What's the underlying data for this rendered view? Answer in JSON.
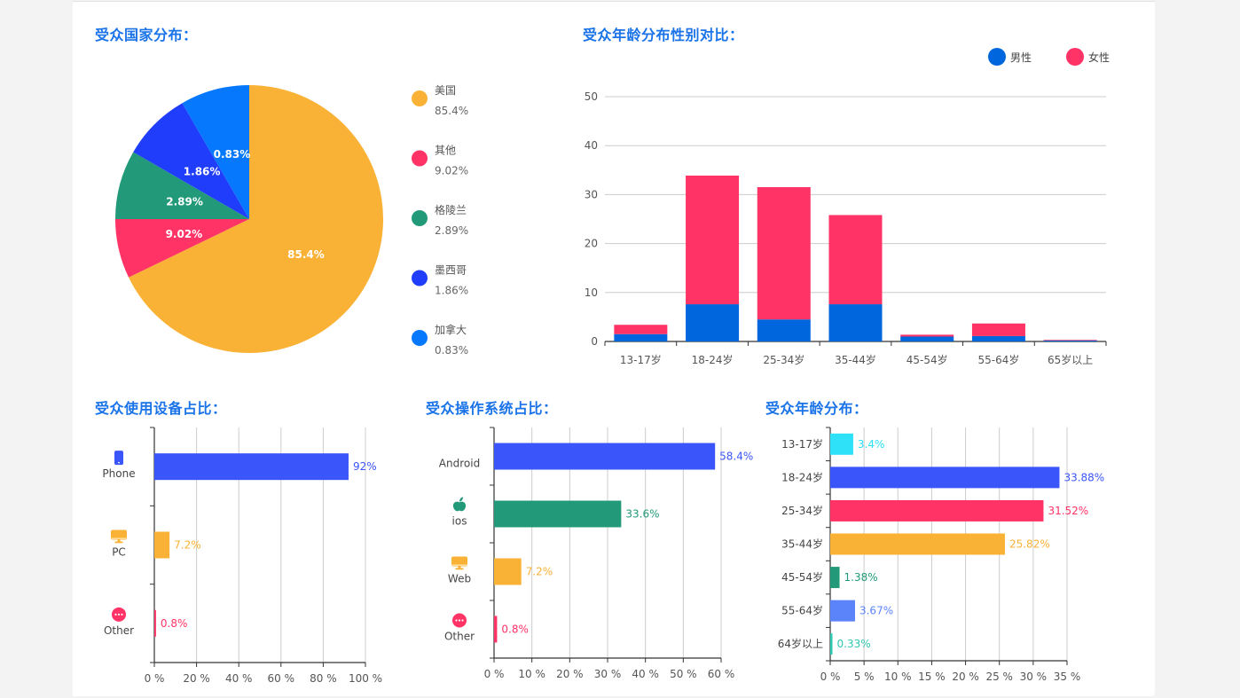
{
  "page": {
    "background": "#f3f3f3",
    "title_color": "#1a73e8"
  },
  "chart_data": [
    {
      "id": "country",
      "type": "pie",
      "title": "受众国家分布：",
      "legend_position": "right",
      "labels_inside": true,
      "slices": [
        {
          "name": "美国",
          "value": 85.4,
          "label": "85.4%",
          "color": "#f9b236"
        },
        {
          "name": "其他",
          "value": 9.02,
          "label": "9.02%",
          "color": "#ff3366"
        },
        {
          "name": "格陵兰",
          "value": 2.89,
          "label": "2.89%",
          "color": "#229a79"
        },
        {
          "name": "墨西哥",
          "value": 1.86,
          "label": "1.86%",
          "color": "#1f3dfb"
        },
        {
          "name": "加拿大",
          "value": 0.83,
          "label": "0.83%",
          "color": "#0678fd"
        }
      ]
    },
    {
      "id": "age_gender",
      "type": "bar",
      "stacked": true,
      "title": "受众年龄分布性别对比：",
      "legend_position": "top-right",
      "categories": [
        "13-17岁",
        "18-24岁",
        "25-34岁",
        "35-44岁",
        "45-54岁",
        "55-64岁",
        "65岁以上"
      ],
      "series": [
        {
          "name": "男性",
          "color": "#0066dd",
          "values": [
            1.5,
            7.6,
            4.5,
            7.6,
            1.0,
            1.1,
            0.2
          ]
        },
        {
          "name": "女性",
          "color": "#ff3366",
          "values": [
            1.9,
            26.28,
            27.02,
            18.22,
            0.38,
            2.57,
            0.13
          ]
        }
      ],
      "ylim": [
        0,
        50
      ],
      "yticks": [
        0,
        10,
        20,
        30,
        40,
        50
      ],
      "grid": true,
      "xlabel": "",
      "ylabel": ""
    },
    {
      "id": "device",
      "type": "bar",
      "orientation": "horizontal",
      "title": "受众使用设备占比：",
      "categories": [
        {
          "name": "Phone",
          "icon": "phone-icon",
          "value": 92,
          "label": "92%",
          "color": "#3a55fa"
        },
        {
          "name": "PC",
          "icon": "monitor-icon",
          "value": 7.2,
          "label": "7.2%",
          "color": "#f9b236"
        },
        {
          "name": "Other",
          "icon": "more-icon",
          "value": 0.8,
          "label": "0.8%",
          "color": "#ff3366"
        }
      ],
      "xlim": [
        0,
        100
      ],
      "xticks": [
        "0 %",
        "20 %",
        "40 %",
        "60 %",
        "80 %",
        "100 %"
      ],
      "grid": true
    },
    {
      "id": "os",
      "type": "bar",
      "orientation": "horizontal",
      "title": "受众操作系统占比：",
      "categories": [
        {
          "name": "Android",
          "icon": "",
          "value": 58.4,
          "label": "58.4%",
          "color": "#3a55fa"
        },
        {
          "name": "ios",
          "icon": "apple-icon",
          "value": 33.6,
          "label": "33.6%",
          "color": "#229a79"
        },
        {
          "name": "Web",
          "icon": "monitor-icon",
          "value": 7.2,
          "label": "7.2%",
          "color": "#f9b236"
        },
        {
          "name": "Other",
          "icon": "more-icon",
          "value": 0.8,
          "label": "0.8%",
          "color": "#ff3366"
        }
      ],
      "xlim": [
        0,
        60
      ],
      "xticks": [
        "0 %",
        "10 %",
        "20 %",
        "30 %",
        "40 %",
        "50 %",
        "60 %"
      ],
      "grid": true
    },
    {
      "id": "age",
      "type": "bar",
      "orientation": "horizontal",
      "title": "受众年龄分布：",
      "categories": [
        {
          "name": "13-17岁",
          "value": 3.4,
          "label": "3.4%",
          "color": "#2ee0f8"
        },
        {
          "name": "18-24岁",
          "value": 33.88,
          "label": "33.88%",
          "color": "#3a55fa"
        },
        {
          "name": "25-34岁",
          "value": 31.52,
          "label": "31.52%",
          "color": "#ff3366"
        },
        {
          "name": "35-44岁",
          "value": 25.82,
          "label": "25.82%",
          "color": "#f9b236"
        },
        {
          "name": "45-54岁",
          "value": 1.38,
          "label": "1.38%",
          "color": "#229a79"
        },
        {
          "name": "55-64岁",
          "value": 3.67,
          "label": "3.67%",
          "color": "#5b84fb"
        },
        {
          "name": "64岁以上",
          "value": 0.33,
          "label": "0.33%",
          "color": "#2ec7b0"
        }
      ],
      "xlim": [
        0,
        35
      ],
      "xticks": [
        "0 %",
        "5 %",
        "10 %",
        "15 %",
        "20 %",
        "25 %",
        "30 %",
        "35 %"
      ],
      "grid": true
    }
  ]
}
